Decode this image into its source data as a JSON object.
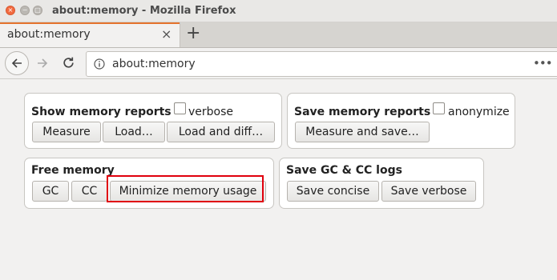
{
  "window": {
    "title": "about:memory - Mozilla Firefox",
    "controls": {
      "close": "×",
      "minimize": "−",
      "maximize": "□"
    }
  },
  "tabs": [
    {
      "label": "about:memory",
      "close": "×"
    }
  ],
  "new_tab_label": "+",
  "navbar": {
    "url": "about:memory",
    "more": "•••"
  },
  "sections": {
    "show": {
      "title": "Show memory reports",
      "checkbox_label": "verbose",
      "buttons": [
        "Measure",
        "Load…",
        "Load and diff…"
      ]
    },
    "save": {
      "title": "Save memory reports",
      "checkbox_label": "anonymize",
      "buttons": [
        "Measure and save…"
      ]
    },
    "free": {
      "title": "Free memory",
      "buttons": [
        "GC",
        "CC",
        "Minimize memory usage"
      ]
    },
    "logs": {
      "title": "Save GC & CC logs",
      "buttons": [
        "Save concise",
        "Save verbose"
      ]
    }
  }
}
